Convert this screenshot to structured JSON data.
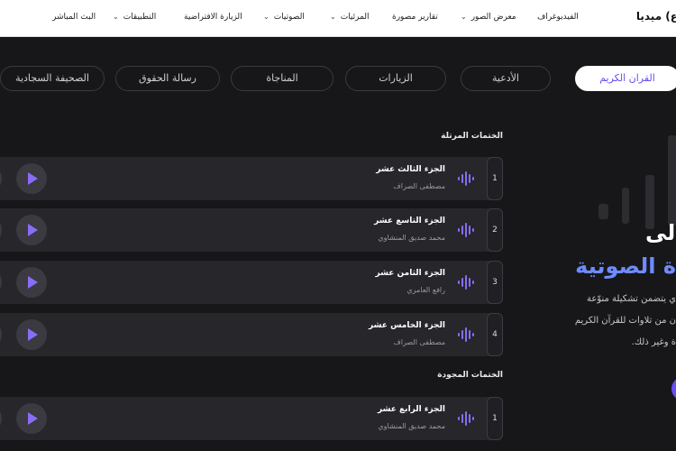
{
  "header": {
    "brand": "ع) ميديا",
    "nav": [
      {
        "label": "الفيديوغراف",
        "has_dropdown": false
      },
      {
        "label": "معرض الصور",
        "has_dropdown": true
      },
      {
        "label": "تقارير مصورة",
        "has_dropdown": false
      },
      {
        "label": "المرئيات",
        "has_dropdown": true
      },
      {
        "label": "الصوتيات",
        "has_dropdown": true
      },
      {
        "label": "الزيارة الافتراضية",
        "has_dropdown": false
      },
      {
        "label": "التطبيقات",
        "has_dropdown": true
      },
      {
        "label": "البث المباشر",
        "has_dropdown": false
      }
    ]
  },
  "tabs": [
    {
      "label": "القران الكريم",
      "active": true
    },
    {
      "label": "الأدعية",
      "active": false
    },
    {
      "label": "الزيارات",
      "active": false
    },
    {
      "label": "المناجاة",
      "active": false
    },
    {
      "label": "رسالة الحقوق",
      "active": false
    },
    {
      "label": "الصحيفة السجادية",
      "active": false
    }
  ],
  "sections": {
    "murattal_title": "الختمات المرتلة",
    "mujawwad_title": "الختمات المجودة"
  },
  "murattal": [
    {
      "num": "1",
      "title": "الجزء الثالث عشر",
      "reciter": "مصطفى الصراف"
    },
    {
      "num": "2",
      "title": "الجزء التاسع عشر",
      "reciter": "محمد صديق المنشاوي"
    },
    {
      "num": "3",
      "title": "الجزء الثامن عشر",
      "reciter": "رافع العامري"
    },
    {
      "num": "4",
      "title": "الجزء الخامس عشر",
      "reciter": "مصطفى الصراف"
    }
  ],
  "mujawwad": [
    {
      "num": "1",
      "title": "الجزء الرابع عشر",
      "reciter": "محمد صديق المنشاوي"
    }
  ],
  "hero": {
    "line1": "لى",
    "line2": "ة الصوتية",
    "desc1": "ي يتضمن تشكيلة منوّعة",
    "desc2": "ن من تلاوات للقرآن الكريم",
    "desc3": "ة وغير ذلك."
  },
  "colors": {
    "accent": "#6b4cf5",
    "hero_blue": "#6e8cff",
    "background": "#17171a",
    "card": "#26262b"
  },
  "icons": {
    "play": "play-triangle",
    "wave": "audio-wave",
    "chevron": "chevron-down"
  }
}
